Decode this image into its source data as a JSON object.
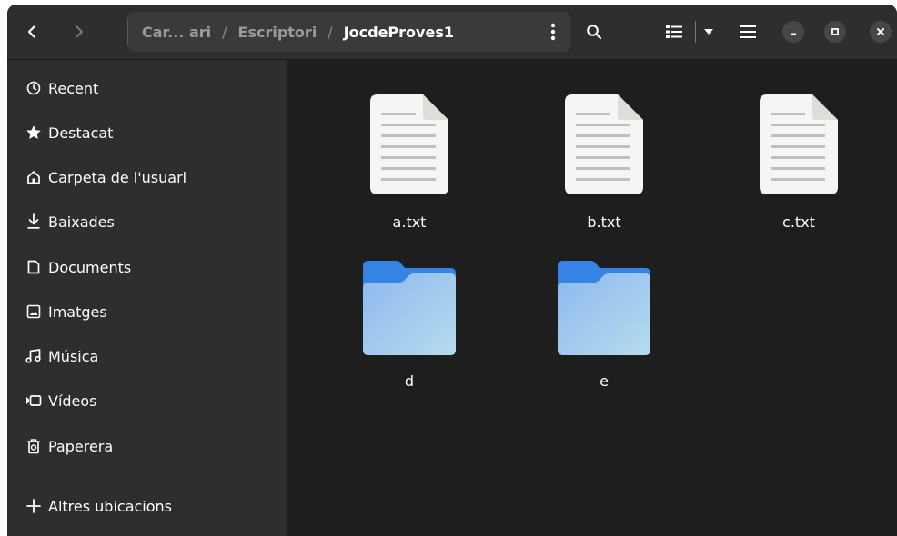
{
  "header": {
    "breadcrumbs": [
      {
        "label": "Car... ari"
      },
      {
        "label": "Escriptori"
      },
      {
        "label": "JocdeProves1"
      }
    ],
    "separator": "/",
    "icons": {
      "back": "chevron-left-icon",
      "forward": "chevron-right-icon",
      "path_menu": "kebab-menu-icon",
      "search": "search-icon",
      "view": "list-view-icon",
      "view_dropdown": "caret-down-icon",
      "main_menu": "hamburger-menu-icon",
      "minimize": "minimize-icon",
      "maximize": "maximize-icon",
      "close": "close-icon"
    }
  },
  "sidebar": {
    "items": [
      {
        "label": "Recent",
        "icon": "clock-icon"
      },
      {
        "label": "Destacat",
        "icon": "star-icon"
      },
      {
        "label": "Carpeta de l'usuari",
        "icon": "home-icon"
      },
      {
        "label": "Baixades",
        "icon": "download-icon"
      },
      {
        "label": "Documents",
        "icon": "document-icon"
      },
      {
        "label": "Imatges",
        "icon": "image-icon"
      },
      {
        "label": "Música",
        "icon": "music-icon"
      },
      {
        "label": "Vídeos",
        "icon": "video-icon"
      },
      {
        "label": "Paperera",
        "icon": "trash-icon"
      }
    ],
    "other_locations": {
      "label": "Altres ubicacions",
      "icon": "plus-icon"
    }
  },
  "files": [
    {
      "name": "a.txt",
      "type": "text-file"
    },
    {
      "name": "b.txt",
      "type": "text-file"
    },
    {
      "name": "c.txt",
      "type": "text-file"
    },
    {
      "name": "d",
      "type": "folder"
    },
    {
      "name": "e",
      "type": "folder"
    }
  ],
  "colors": {
    "window_bg": "#242424",
    "headerbar_bg": "#2e2e2e",
    "sidebar_bg": "#2e2e2e",
    "content_bg": "#1e1e1e",
    "folder_back": "#3584e4",
    "folder_front": "#99c1f1",
    "text": "#ffffff"
  }
}
